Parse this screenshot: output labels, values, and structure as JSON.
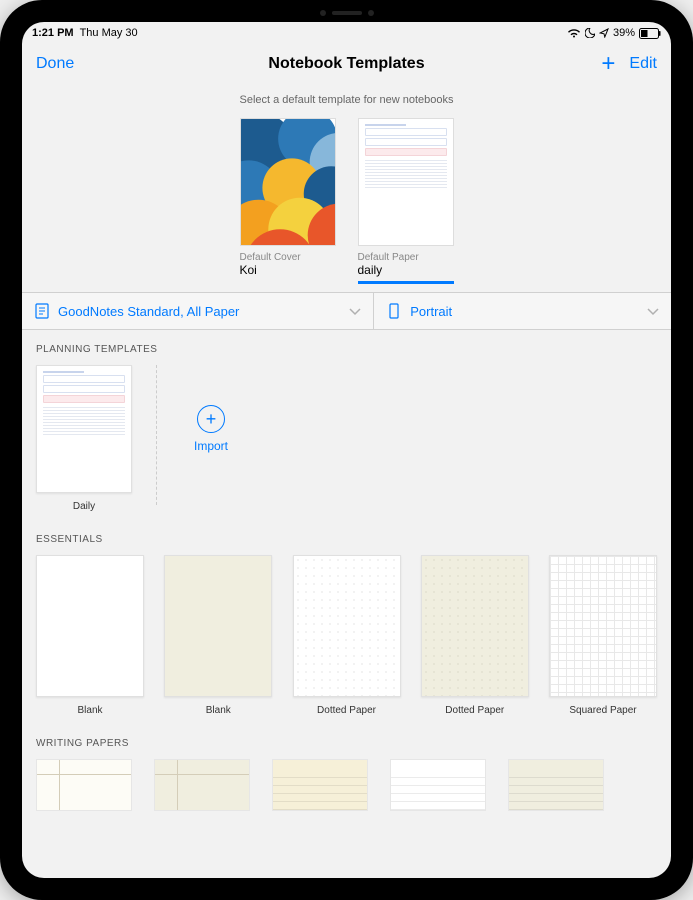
{
  "status_bar": {
    "time": "1:21 PM",
    "date": "Thu May 30",
    "battery_pct": "39%"
  },
  "nav": {
    "done": "Done",
    "title": "Notebook Templates",
    "edit": "Edit"
  },
  "subtitle": "Select a default template for new notebooks",
  "defaults": {
    "cover_label": "Default Cover",
    "cover_value": "Koi",
    "paper_label": "Default Paper",
    "paper_value": "daily"
  },
  "filters": {
    "paper_set": "GoodNotes Standard, All Paper",
    "orientation": "Portrait"
  },
  "sections": {
    "planning": {
      "title": "PLANNING TEMPLATES",
      "items": [
        {
          "name": "Daily"
        }
      ],
      "import_label": "Import"
    },
    "essentials": {
      "title": "ESSENTIALS",
      "items": [
        {
          "name": "Blank"
        },
        {
          "name": "Blank"
        },
        {
          "name": "Dotted Paper"
        },
        {
          "name": "Dotted Paper"
        },
        {
          "name": "Squared Paper"
        }
      ]
    },
    "writing": {
      "title": "WRITING PAPERS"
    }
  }
}
